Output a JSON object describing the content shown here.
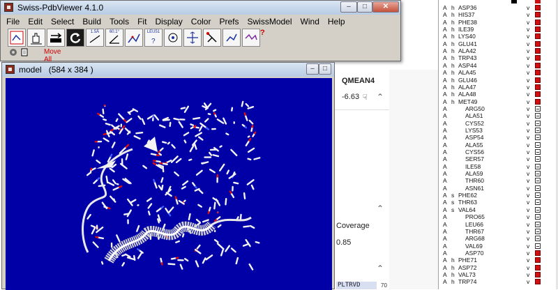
{
  "main_window": {
    "title": "Swiss-PdbViewer 4.1.0",
    "menu": [
      "File",
      "Edit",
      "Select",
      "Build",
      "Tools",
      "Fit",
      "Display",
      "Color",
      "Prefs",
      "SwissModel",
      "Wind",
      "Help"
    ],
    "toolbar_labels": [
      "1.5Å",
      "60.1°",
      "LEU51"
    ],
    "toolbar_tools": [
      "fit-window",
      "move",
      "zoom",
      "rotate",
      "distance",
      "angle",
      "torsion",
      "identify",
      "center",
      "select-neighbors",
      "mutate",
      "rotate-side-chain",
      "torsion-select"
    ],
    "help_mark": "?",
    "status_label": "Move All",
    "status_color": "#cc0000"
  },
  "model_window": {
    "title": "model",
    "size_label": "(584 x 384 )",
    "background": "#0000a6"
  },
  "background_page": {
    "qmean_label": "QMEAN4",
    "qmean_value": "-6.63",
    "coverage_label": "Coverage",
    "coverage_value": "0.85",
    "sequence_fragment": "PLTRVD",
    "sequence_number": "70"
  },
  "residues": [
    {
      "chain": "A",
      "ss": "h",
      "name": "ASP36",
      "v": "v",
      "box": "red"
    },
    {
      "chain": "A",
      "ss": "h",
      "name": "HIS37",
      "v": "v",
      "box": "red"
    },
    {
      "chain": "A",
      "ss": "h",
      "name": "PHE38",
      "v": "v",
      "box": "red"
    },
    {
      "chain": "A",
      "ss": "h",
      "name": "ILE39",
      "v": "v",
      "box": "red"
    },
    {
      "chain": "A",
      "ss": "h",
      "name": "LYS40",
      "v": "v",
      "box": "red"
    },
    {
      "chain": "A",
      "ss": "h",
      "name": "GLU41",
      "v": "v",
      "box": "red"
    },
    {
      "chain": "A",
      "ss": "h",
      "name": "ALA42",
      "v": "v",
      "box": "red"
    },
    {
      "chain": "A",
      "ss": "h",
      "name": "TRP43",
      "v": "v",
      "box": "red"
    },
    {
      "chain": "A",
      "ss": "h",
      "name": "ASP44",
      "v": "v",
      "box": "red"
    },
    {
      "chain": "A",
      "ss": "h",
      "name": "ALA45",
      "v": "v",
      "box": "red"
    },
    {
      "chain": "A",
      "ss": "h",
      "name": "GLU46",
      "v": "v",
      "box": "red"
    },
    {
      "chain": "A",
      "ss": "h",
      "name": "ALA47",
      "v": "v",
      "box": "red"
    },
    {
      "chain": "A",
      "ss": "h",
      "name": "ALA48",
      "v": "v",
      "box": "red"
    },
    {
      "chain": "A",
      "ss": "h",
      "name": "MET49",
      "v": "v",
      "box": "red"
    },
    {
      "chain": "A",
      "ss": "",
      "name": "ARG50",
      "v": "v",
      "box": "empty"
    },
    {
      "chain": "A",
      "ss": "",
      "name": "ALA51",
      "v": "v",
      "box": "empty"
    },
    {
      "chain": "A",
      "ss": "",
      "name": "CYS52",
      "v": "v",
      "box": "empty"
    },
    {
      "chain": "A",
      "ss": "",
      "name": "LYS53",
      "v": "v",
      "box": "empty"
    },
    {
      "chain": "A",
      "ss": "",
      "name": "ASP54",
      "v": "v",
      "box": "empty"
    },
    {
      "chain": "A",
      "ss": "",
      "name": "ALA55",
      "v": "v",
      "box": "empty"
    },
    {
      "chain": "A",
      "ss": "",
      "name": "CYS56",
      "v": "v",
      "box": "empty"
    },
    {
      "chain": "A",
      "ss": "",
      "name": "SER57",
      "v": "v",
      "box": "empty"
    },
    {
      "chain": "A",
      "ss": "",
      "name": "ILE58",
      "v": "v",
      "box": "empty"
    },
    {
      "chain": "A",
      "ss": "",
      "name": "ALA59",
      "v": "v",
      "box": "empty"
    },
    {
      "chain": "A",
      "ss": "",
      "name": "THR60",
      "v": "v",
      "box": "empty"
    },
    {
      "chain": "A",
      "ss": "",
      "name": "ASN61",
      "v": "v",
      "box": "empty"
    },
    {
      "chain": "A",
      "ss": "s",
      "name": "PHE62",
      "v": "v",
      "box": "empty"
    },
    {
      "chain": "A",
      "ss": "s",
      "name": "THR63",
      "v": "v",
      "box": "empty"
    },
    {
      "chain": "A",
      "ss": "s",
      "name": "VAL64",
      "v": "v",
      "box": "empty"
    },
    {
      "chain": "A",
      "ss": "",
      "name": "PRO65",
      "v": "v",
      "box": "empty"
    },
    {
      "chain": "A",
      "ss": "",
      "name": "LEU66",
      "v": "v",
      "box": "empty"
    },
    {
      "chain": "A",
      "ss": "",
      "name": "THR67",
      "v": "v",
      "box": "empty"
    },
    {
      "chain": "A",
      "ss": "",
      "name": "ARG68",
      "v": "v",
      "box": "empty"
    },
    {
      "chain": "A",
      "ss": "",
      "name": "VAL69",
      "v": "v",
      "box": "empty"
    },
    {
      "chain": "A",
      "ss": "",
      "name": "ASP70",
      "v": "v",
      "box": "red"
    },
    {
      "chain": "A",
      "ss": "h",
      "name": "PHE71",
      "v": "v",
      "box": "red"
    },
    {
      "chain": "A",
      "ss": "h",
      "name": "ASP72",
      "v": "v",
      "box": "red"
    },
    {
      "chain": "A",
      "ss": "h",
      "name": "VAL73",
      "v": "v",
      "box": "red"
    },
    {
      "chain": "A",
      "ss": "h",
      "name": "TRP74",
      "v": "v",
      "box": "red"
    }
  ]
}
